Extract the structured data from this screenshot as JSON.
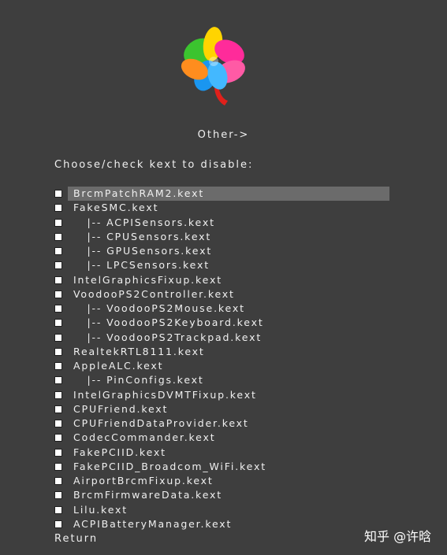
{
  "logo": {
    "icon": "clover-logo-icon"
  },
  "section_title": "Other->",
  "instruction": "Choose/check kext to disable:",
  "kexts": [
    {
      "label": "BrcmPatchRAM2.kext",
      "selected": true
    },
    {
      "label": "FakeSMC.kext"
    },
    {
      "label": "   |-- ACPISensors.kext"
    },
    {
      "label": "   |-- CPUSensors.kext"
    },
    {
      "label": "   |-- GPUSensors.kext"
    },
    {
      "label": "   |-- LPCSensors.kext"
    },
    {
      "label": "IntelGraphicsFixup.kext"
    },
    {
      "label": "VoodooPS2Controller.kext"
    },
    {
      "label": "   |-- VoodooPS2Mouse.kext"
    },
    {
      "label": "   |-- VoodooPS2Keyboard.kext"
    },
    {
      "label": "   |-- VoodooPS2Trackpad.kext"
    },
    {
      "label": "RealtekRTL8111.kext"
    },
    {
      "label": "AppleALC.kext"
    },
    {
      "label": "   |-- PinConfigs.kext"
    },
    {
      "label": "IntelGraphicsDVMTFixup.kext"
    },
    {
      "label": "CPUFriend.kext"
    },
    {
      "label": "CPUFriendDataProvider.kext"
    },
    {
      "label": "CodecCommander.kext"
    },
    {
      "label": "FakePCIID.kext"
    },
    {
      "label": "FakePCIID_Broadcom_WiFi.kext"
    },
    {
      "label": "AirportBrcmFixup.kext"
    },
    {
      "label": "BrcmFirmwareData.kext"
    },
    {
      "label": "Lilu.kext"
    },
    {
      "label": "ACPIBatteryManager.kext"
    }
  ],
  "return_label": "Return",
  "watermark": "知乎 @许晗"
}
